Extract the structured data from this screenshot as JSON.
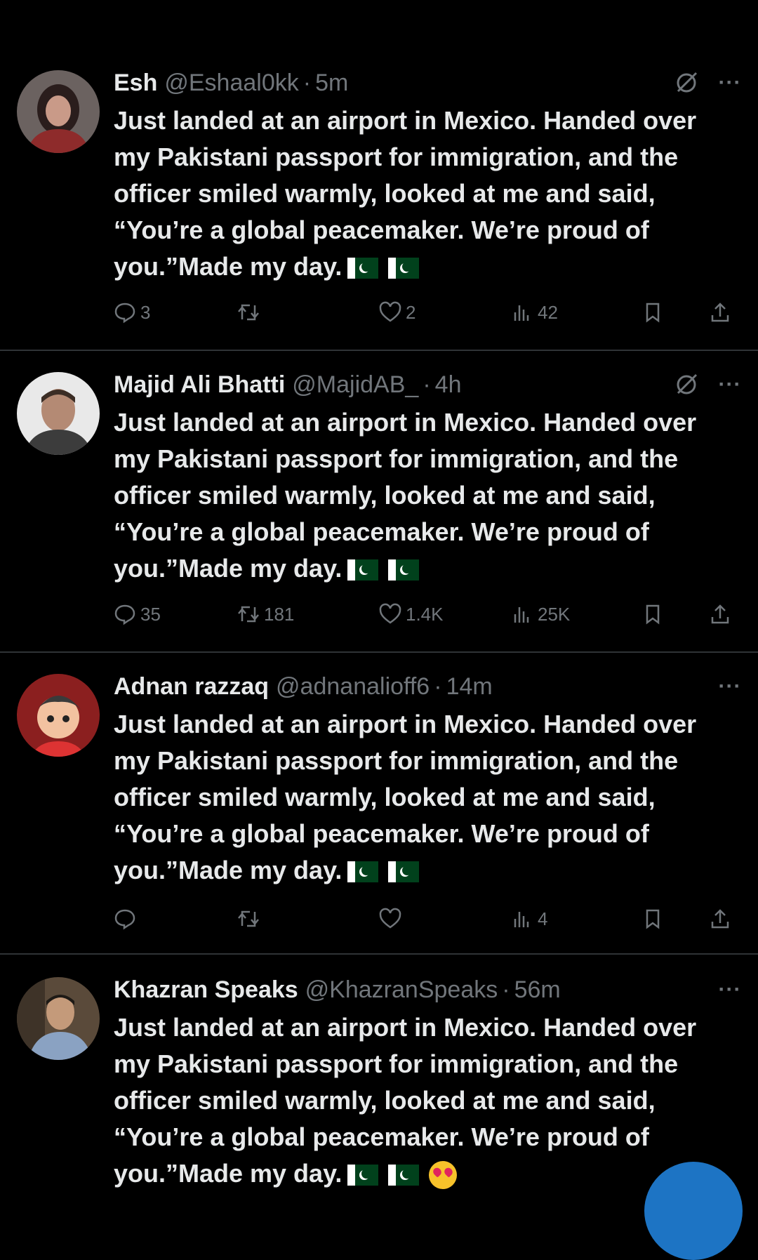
{
  "tweets": [
    {
      "name": "Esh",
      "handle": "@Eshaal0kk",
      "time": "5m",
      "text": "Just landed at an airport in Mexico. Handed over my Pakistani passport for immigration, and the officer smiled warmly, looked at me and said, “You’re a global peacemaker. We’re proud of you.”Made my day.",
      "emoji": "flags",
      "grok": true,
      "replies": "3",
      "reposts": "",
      "likes": "2",
      "views": "42"
    },
    {
      "name": "Majid Ali Bhatti",
      "handle": "@MajidAB_",
      "time": "4h",
      "text": "Just landed at an airport in Mexico. Handed over my Pakistani passport for immigration, and the officer smiled warmly, looked at me and said, “You’re a global peacemaker. We’re proud of you.”Made my day.",
      "emoji": "flags",
      "grok": true,
      "replies": "35",
      "reposts": "181",
      "likes": "1.4K",
      "views": "25K"
    },
    {
      "name": "Adnan razzaq",
      "handle": "@adnanalioff6",
      "time": "14m",
      "text": "Just landed at an airport in Mexico. Handed over my Pakistani passport for immigration, and the officer smiled warmly, looked at me and said, “You’re a global peacemaker. We’re proud of you.”Made my day.",
      "emoji": "flags",
      "grok": false,
      "replies": "",
      "reposts": "",
      "likes": "",
      "views": "4"
    },
    {
      "name": "Khazran Speaks",
      "handle": "@KhazranSpeaks",
      "time": "56m",
      "text": "Just landed at an airport in Mexico. Handed over my Pakistani passport for immigration, and the officer smiled warmly, looked at me and said, “You’re a global peacemaker. We’re proud of you.”Made my day.",
      "emoji": "flags-heart-eyes",
      "grok": false
    }
  ],
  "separator": "·",
  "more_label": "···",
  "colors": {
    "background": "#000000",
    "text": "#e7e9ea",
    "muted": "#71767b",
    "divider": "#2f3336",
    "fab": "#1d74c4"
  },
  "icons": [
    "reply-icon",
    "repost-icon",
    "like-icon",
    "views-icon",
    "bookmark-icon",
    "share-icon",
    "grok-icon",
    "more-icon"
  ]
}
